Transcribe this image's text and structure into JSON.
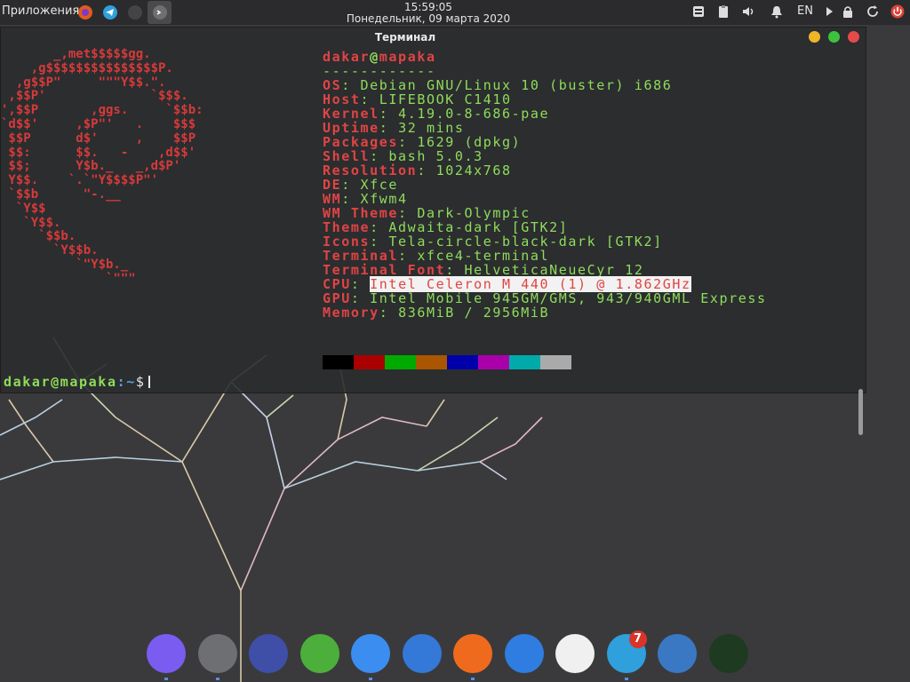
{
  "top_panel": {
    "apps_menu": "Приложения",
    "time": "15:59:05",
    "date": "Понедельник, 09 марта 2020",
    "lang": "EN",
    "launchers": [
      "firefox-icon",
      "telegram-icon",
      "terminal-small-icon",
      "terminal-active-icon"
    ],
    "tray": [
      "storage-icon",
      "clipboard-icon",
      "volume-icon",
      "notifications-icon",
      "play-icon",
      "lock-icon",
      "refresh-icon",
      "power-icon"
    ]
  },
  "terminal": {
    "title": "Терминал",
    "logo": "       _,met$$$$$gg.\n    ,g$$$$$$$$$$$$$$$P.\n  ,g$$P\"     \"\"\"Y$$.\".\n ,$$P'              `$$$.\n',$$P       ,ggs.     `$$b:\n`d$$'     ,$P\"'   .    $$$\n $$P      d$'     ,    $$P\n $$:      $$.   -    ,d$$'\n $$;      Y$b._   _,d$P'\n Y$$.    `.`\"Y$$$$P\"'\n `$$b      \"-.__\n  `Y$$\n   `Y$$.\n     `$$b.\n       `Y$$b.\n          `\"Y$b._\n              `\"\"\"",
    "user": "dakar",
    "at": "@",
    "host": "mapaka",
    "separator": "------------",
    "info": [
      {
        "key": "OS",
        "value": "Debian GNU/Linux 10 (buster) i686"
      },
      {
        "key": "Host",
        "value": "LIFEBOOK C1410"
      },
      {
        "key": "Kernel",
        "value": "4.19.0-8-686-pae"
      },
      {
        "key": "Uptime",
        "value": "32 mins"
      },
      {
        "key": "Packages",
        "value": "1629 (dpkg)"
      },
      {
        "key": "Shell",
        "value": "bash 5.0.3"
      },
      {
        "key": "Resolution",
        "value": "1024x768"
      },
      {
        "key": "DE",
        "value": "Xfce"
      },
      {
        "key": "WM",
        "value": "Xfwm4"
      },
      {
        "key": "WM Theme",
        "value": "Dark-Olympic"
      },
      {
        "key": "Theme",
        "value": "Adwaita-dark [GTK2]"
      },
      {
        "key": "Icons",
        "value": "Tela-circle-black-dark [GTK2]"
      },
      {
        "key": "Terminal",
        "value": "xfce4-terminal"
      },
      {
        "key": "Terminal Font",
        "value": "HelveticaNeueCyr 12"
      },
      {
        "key": "CPU",
        "value": "Intel Celeron M 440 (1) @ 1.862GHz"
      },
      {
        "key": "GPU",
        "value": "Intel Mobile 945GM/GMS, 943/940GML Express"
      },
      {
        "key": "Memory",
        "value": "836MiB / 2956MiB"
      }
    ],
    "palette": [
      "#000000",
      "#aa0000",
      "#00aa00",
      "#aa5500",
      "#0000aa",
      "#aa00aa",
      "#00aaaa",
      "#aaaaaa"
    ],
    "prompt_user": "dakar@mapaka",
    "prompt_path": ":~",
    "prompt_symbol": "$"
  },
  "dock": {
    "items": [
      {
        "name": "files-icon",
        "color": "#7a5cf0"
      },
      {
        "name": "terminal-icon",
        "color": "#6d6f73"
      },
      {
        "name": "system-monitor-icon",
        "color": "#3f4fa8"
      },
      {
        "name": "leafpad-icon",
        "color": "#4caf3c"
      },
      {
        "name": "chromium-icon",
        "color": "#3b8ef0"
      },
      {
        "name": "toggle-app-icon",
        "color": "#3478d8"
      },
      {
        "name": "firefox-icon",
        "color": "#f06a1e"
      },
      {
        "name": "qbittorrent-icon",
        "color": "#2f7de0"
      },
      {
        "name": "white-circle-app-icon",
        "color": "#f0f0f0"
      },
      {
        "name": "telegram-icon",
        "color": "#2fa0dc",
        "badge": "7"
      },
      {
        "name": "vk-icon",
        "color": "#3a78c4"
      },
      {
        "name": "radar-icon",
        "color": "#1e3a20"
      }
    ]
  }
}
